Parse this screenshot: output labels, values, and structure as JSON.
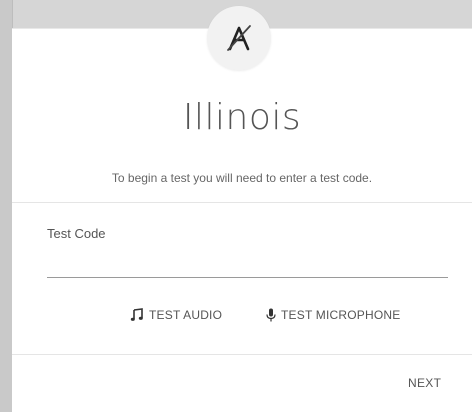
{
  "card": {
    "logo_icon": "a-letter-logo-icon",
    "state_name": "Illinois",
    "instruction": "To begin a test you will need to enter a test code.",
    "test_code": {
      "label": "Test Code",
      "value": ""
    },
    "buttons": {
      "test_audio": {
        "label": "TEST AUDIO",
        "icon": "music-note-icon"
      },
      "test_microphone": {
        "label": "TEST MICROPHONE",
        "icon": "microphone-icon"
      }
    },
    "next_label": "NEXT"
  },
  "colors": {
    "background": "#d6d6d6",
    "card": "#ffffff",
    "text": "#555555",
    "logo_circle": "#f2f2f2"
  }
}
